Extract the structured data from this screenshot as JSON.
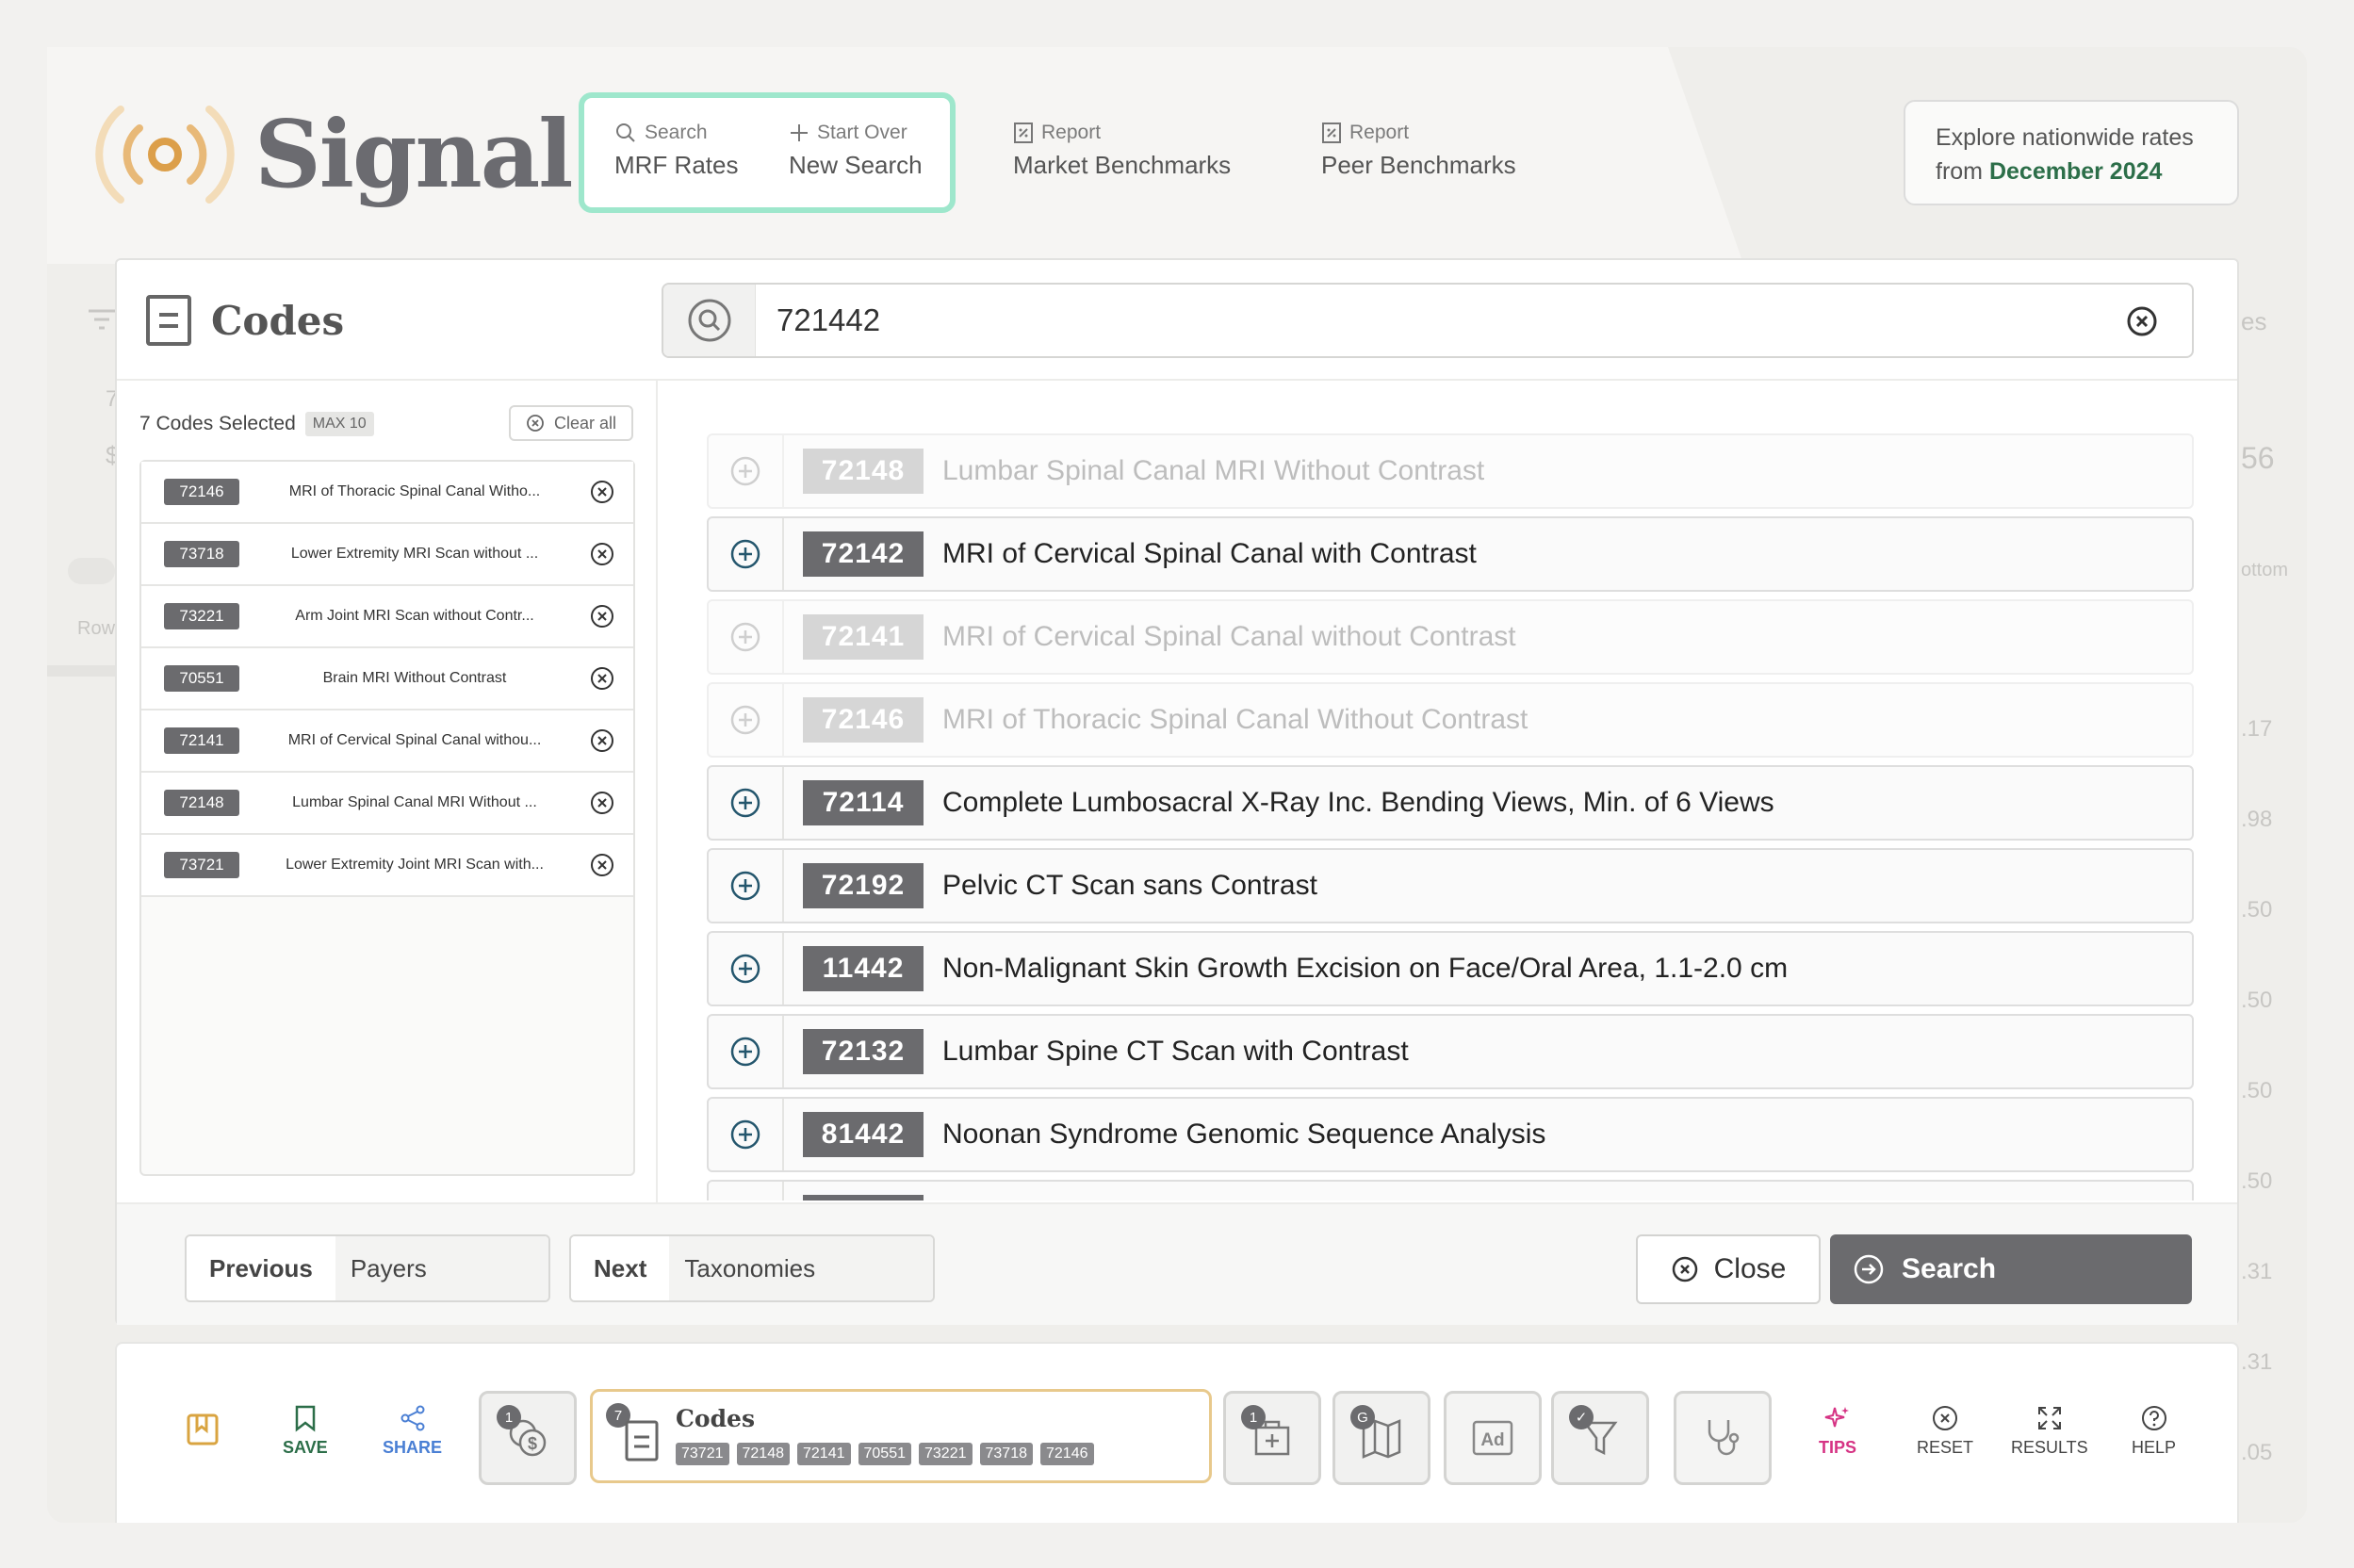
{
  "app": {
    "logo_text": "Signal",
    "colors": {
      "accent_green": "#2c6e49",
      "active_border": "#9ee7cc",
      "code_badge": "#6b6b6e",
      "tips_pink": "#d63384",
      "save_green": "#2c6e49",
      "share_blue": "#4a7fd4",
      "bookmark_amber": "#d9a441"
    }
  },
  "nav": {
    "search": {
      "small": "Search",
      "large": "MRF Rates",
      "icon": "search-icon"
    },
    "start_over": {
      "small": "Start Over",
      "large": "New Search",
      "icon": "plus-icon"
    },
    "market": {
      "small": "Report",
      "large": "Market Benchmarks",
      "icon": "report-icon"
    },
    "peer": {
      "small": "Report",
      "large": "Peer Benchmarks",
      "icon": "report-icon"
    },
    "explore": {
      "line1": "Explore nationwide rates",
      "line2_prefix": "from ",
      "line2_date": "December 2024"
    }
  },
  "background_ghost": {
    "right_es": "es",
    "right_56": "56",
    "right_ottom": "ottom",
    "left_row": "Row",
    "left_7": "7",
    "left_dollar": "$",
    "right_values": [
      ".17",
      ".98",
      ".50",
      ".50",
      ".50",
      ".50",
      ".31",
      ".31",
      ".05"
    ]
  },
  "codes_modal": {
    "title": "Codes",
    "search": {
      "value": "721442",
      "placeholder": ""
    },
    "selected": {
      "count_label": "7 Codes Selected",
      "max_label": "MAX 10",
      "clear_label": "Clear all",
      "items": [
        {
          "code": "72146",
          "name": "MRI of Thoracic Spinal Canal Witho..."
        },
        {
          "code": "73718",
          "name": "Lower Extremity MRI Scan without ..."
        },
        {
          "code": "73221",
          "name": "Arm Joint MRI Scan without Contr..."
        },
        {
          "code": "70551",
          "name": "Brain MRI Without Contrast"
        },
        {
          "code": "72141",
          "name": "MRI of Cervical Spinal Canal withou..."
        },
        {
          "code": "72148",
          "name": "Lumbar Spinal Canal MRI Without ..."
        },
        {
          "code": "73721",
          "name": "Lower Extremity Joint MRI Scan with..."
        }
      ]
    },
    "results": [
      {
        "code": "72148",
        "name": "Lumbar Spinal Canal MRI Without Contrast",
        "disabled": true
      },
      {
        "code": "72142",
        "name": "MRI of Cervical Spinal Canal with Contrast",
        "disabled": false
      },
      {
        "code": "72141",
        "name": "MRI of Cervical Spinal Canal without Contrast",
        "disabled": true
      },
      {
        "code": "72146",
        "name": "MRI of Thoracic Spinal Canal Without Contrast",
        "disabled": true
      },
      {
        "code": "72114",
        "name": "Complete Lumbosacral X-Ray Inc. Bending Views, Min. of 6 Views",
        "disabled": false
      },
      {
        "code": "72192",
        "name": "Pelvic CT Scan sans Contrast",
        "disabled": false
      },
      {
        "code": "11442",
        "name": "Non-Malignant Skin Growth Excision on Face/Oral Area, 1.1-2.0 cm",
        "disabled": false
      },
      {
        "code": "72132",
        "name": "Lumbar Spine CT Scan with Contrast",
        "disabled": false
      },
      {
        "code": "81442",
        "name": "Noonan Syndrome Genomic Sequence Analysis",
        "disabled": false
      },
      {
        "code": "",
        "name": "",
        "disabled": false
      }
    ],
    "footer": {
      "previous_key": "Previous",
      "previous_value": "Payers",
      "next_key": "Next",
      "next_value": "Taxonomies",
      "close_label": "Close",
      "search_label": "Search"
    }
  },
  "toolbar": {
    "save_label": "SAVE",
    "share_label": "SHARE",
    "payers_badge": "1",
    "codes_badge": "7",
    "codes_title": "Codes",
    "codes_chips": [
      "73721",
      "72148",
      "72141",
      "70551",
      "73221",
      "73718",
      "72146"
    ],
    "facility_badge": "1",
    "map_badge": "G",
    "filter_badge": "✓",
    "tips_label": "TIPS",
    "reset_label": "RESET",
    "results_label": "RESULTS",
    "help_label": "HELP"
  }
}
